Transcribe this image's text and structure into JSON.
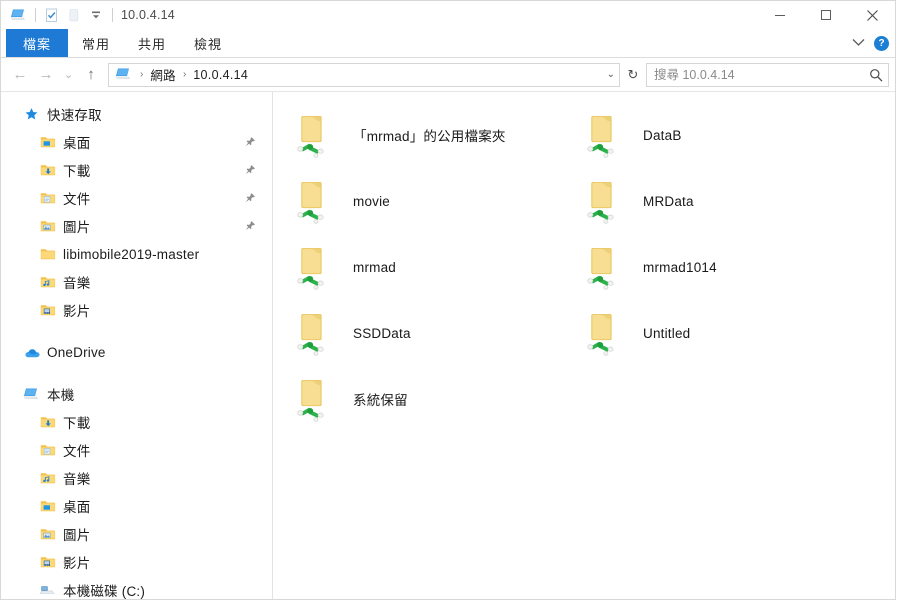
{
  "window": {
    "title": "10.0.4.14",
    "quick_access_toolbar": [
      {
        "name": "network-computer-icon",
        "label": "網路電腦"
      },
      {
        "name": "properties-icon",
        "label": "內容"
      },
      {
        "name": "new-folder-icon",
        "label": "新增資料夾"
      },
      {
        "name": "customize-quick-access-dropdown-icon",
        "label": "自訂快速存取工具列"
      }
    ],
    "controls": {
      "minimize": "最小化",
      "maximize": "最大化",
      "close": "關閉"
    }
  },
  "ribbon": {
    "tabs": [
      {
        "label": "檔案",
        "active": true
      },
      {
        "label": "常用",
        "active": false
      },
      {
        "label": "共用",
        "active": false
      },
      {
        "label": "檢視",
        "active": false
      }
    ],
    "collapse_icon": "chevron-down-icon",
    "help_label": "?"
  },
  "address_bar": {
    "back": "←",
    "forward": "→",
    "recent": "⌄",
    "up": "↑",
    "breadcrumb": {
      "icon": "network-computer-icon",
      "parts": [
        "網路",
        "10.0.4.14"
      ],
      "separator": "›",
      "dropdown": "⌄"
    },
    "refresh": "↻",
    "search": {
      "placeholder": "搜尋 10.0.4.14",
      "value": "",
      "icon": "search-icon"
    }
  },
  "sidebar": {
    "groups": [
      {
        "header": {
          "label": "快速存取",
          "icon": "star-icon"
        },
        "items": [
          {
            "label": "桌面",
            "icon": "desktop-folder-icon",
            "pinned": true
          },
          {
            "label": "下載",
            "icon": "downloads-folder-icon",
            "pinned": true
          },
          {
            "label": "文件",
            "icon": "documents-folder-icon",
            "pinned": true
          },
          {
            "label": "圖片",
            "icon": "pictures-folder-icon",
            "pinned": true
          },
          {
            "label": "libimobile2019-master",
            "icon": "folder-icon",
            "pinned": false
          },
          {
            "label": "音樂",
            "icon": "music-folder-icon",
            "pinned": false
          },
          {
            "label": "影片",
            "icon": "videos-folder-icon",
            "pinned": false
          }
        ]
      },
      {
        "header": {
          "label": "OneDrive",
          "icon": "onedrive-cloud-icon"
        },
        "items": []
      },
      {
        "header": {
          "label": "本機",
          "icon": "this-pc-icon"
        },
        "items": [
          {
            "label": "下載",
            "icon": "downloads-folder-icon",
            "pinned": false
          },
          {
            "label": "文件",
            "icon": "documents-folder-icon",
            "pinned": false
          },
          {
            "label": "音樂",
            "icon": "music-folder-icon",
            "pinned": false
          },
          {
            "label": "桌面",
            "icon": "desktop-folder-icon",
            "pinned": false
          },
          {
            "label": "圖片",
            "icon": "pictures-folder-icon",
            "pinned": false
          },
          {
            "label": "影片",
            "icon": "videos-folder-icon",
            "pinned": false
          },
          {
            "label": "本機磁碟 (C:)",
            "icon": "local-disk-icon",
            "pinned": false
          }
        ]
      }
    ],
    "pin_icon": "pin-icon"
  },
  "main": {
    "view": "tiles",
    "items": [
      {
        "name": "「mrmad」的公用檔案夾",
        "icon": "shared-folder-icon",
        "column": 0
      },
      {
        "name": "DataB",
        "icon": "shared-folder-icon",
        "column": 1
      },
      {
        "name": "movie",
        "icon": "shared-folder-icon",
        "column": 0
      },
      {
        "name": "MRData",
        "icon": "shared-folder-icon",
        "column": 1
      },
      {
        "name": "mrmad",
        "icon": "shared-folder-icon",
        "column": 0
      },
      {
        "name": "mrmad1014",
        "icon": "shared-folder-icon",
        "column": 1
      },
      {
        "name": "SSDData",
        "icon": "shared-folder-icon",
        "column": 0
      },
      {
        "name": "Untitled",
        "icon": "shared-folder-icon",
        "column": 1
      },
      {
        "name": "系統保留",
        "icon": "shared-folder-icon",
        "column": 0
      }
    ]
  },
  "colors": {
    "accent_blue": "#1e7ad4",
    "folder_yellow": "#f5d77e",
    "share_green": "#23b14d",
    "border_gray": "#d8d8d8"
  }
}
